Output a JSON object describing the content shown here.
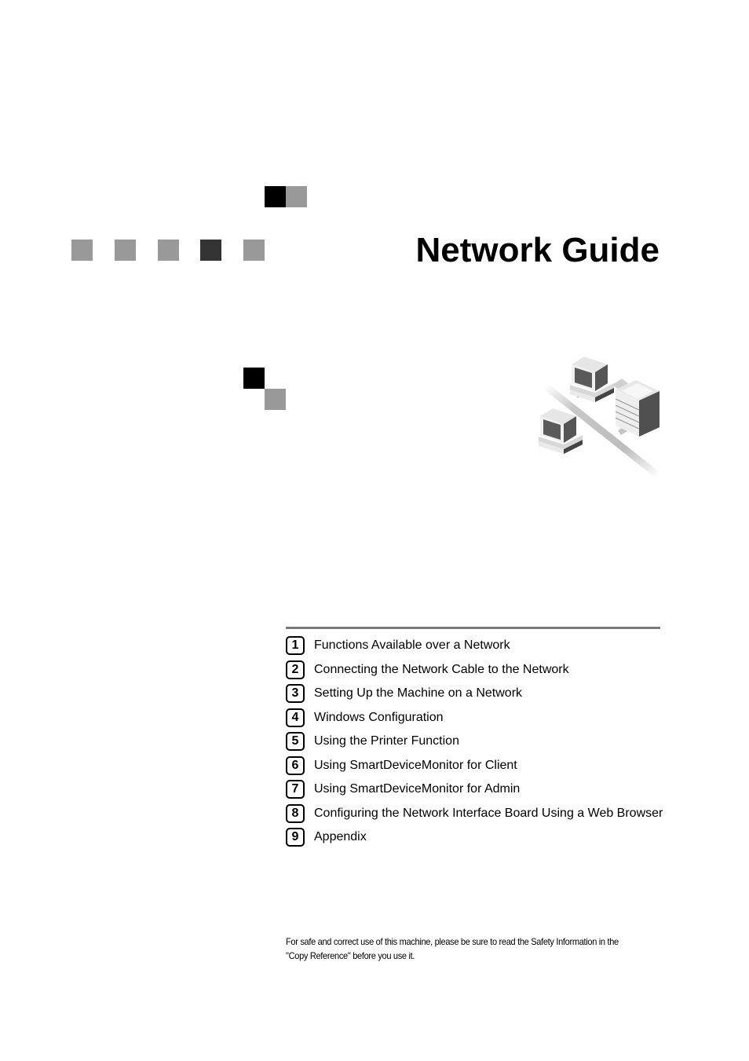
{
  "document": {
    "title": "Network Guide",
    "illustration": "network-illustration-two-computers-and-printer-icon",
    "toc": [
      {
        "number": "1",
        "label": "Functions Available over a Network"
      },
      {
        "number": "2",
        "label": "Connecting the Network Cable to the Network"
      },
      {
        "number": "3",
        "label": "Setting Up the Machine on a Network"
      },
      {
        "number": "4",
        "label": "Windows Configuration"
      },
      {
        "number": "5",
        "label": "Using the Printer Function"
      },
      {
        "number": "6",
        "label": "Using SmartDeviceMonitor for Client"
      },
      {
        "number": "7",
        "label": "Using SmartDeviceMonitor for Admin"
      },
      {
        "number": "8",
        "label": "Configuring the Network Interface Board Using a Web Browser"
      },
      {
        "number": "9",
        "label": "Appendix"
      }
    ],
    "safety_note_line1": "For safe and correct use of this machine, please be sure to read the Safety Information in the",
    "safety_note_line2": "\"Copy Reference\" before you use it."
  },
  "colors": {
    "black_square": "#000000",
    "dark_square": "#333333",
    "gray_square": "#999999",
    "rule": "#7a7a7a"
  }
}
